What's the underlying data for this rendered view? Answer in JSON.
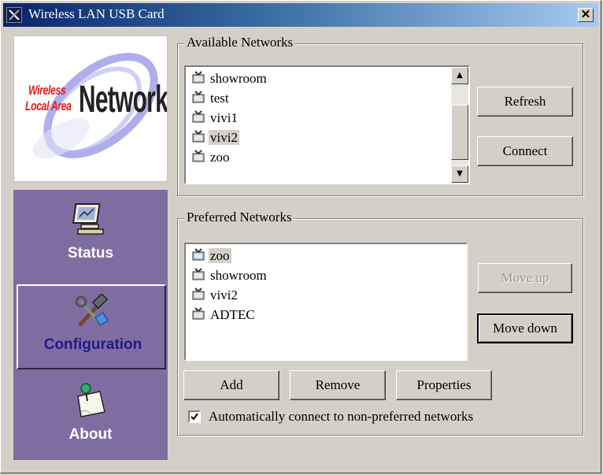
{
  "window": {
    "title": "Wireless LAN USB Card",
    "close_symbol": "✕"
  },
  "logo": {
    "line1": "Wireless",
    "line2": "Local Area",
    "line3": "Network"
  },
  "nav": {
    "items": [
      {
        "label": "Status",
        "icon": "monitor-icon",
        "active": false
      },
      {
        "label": "Configuration",
        "icon": "tools-icon",
        "active": true
      },
      {
        "label": "About",
        "icon": "note-pin-icon",
        "active": false
      }
    ],
    "color": "#7f6da2",
    "active_text_color": "#201a85"
  },
  "available": {
    "title": "Available Networks",
    "networks": [
      "showroom",
      "test",
      "vivi1",
      "vivi2",
      "zoo"
    ],
    "selected": "vivi2",
    "refresh_label": "Refresh",
    "refresh_accel": "R",
    "connect_label": "Connect",
    "connect_accel": "C"
  },
  "preferred": {
    "title": "Preferred Networks",
    "networks": [
      "zoo",
      "showroom",
      "vivi2",
      "ADTEC"
    ],
    "selected": "zoo",
    "move_up_label": "Move up",
    "move_down_label": "Move down",
    "add_label": "Add",
    "remove_label": "Remove",
    "properties_label": "Properties"
  },
  "auto_connect": {
    "checked": true,
    "label": "Automatically connect to non-preferred networks"
  }
}
